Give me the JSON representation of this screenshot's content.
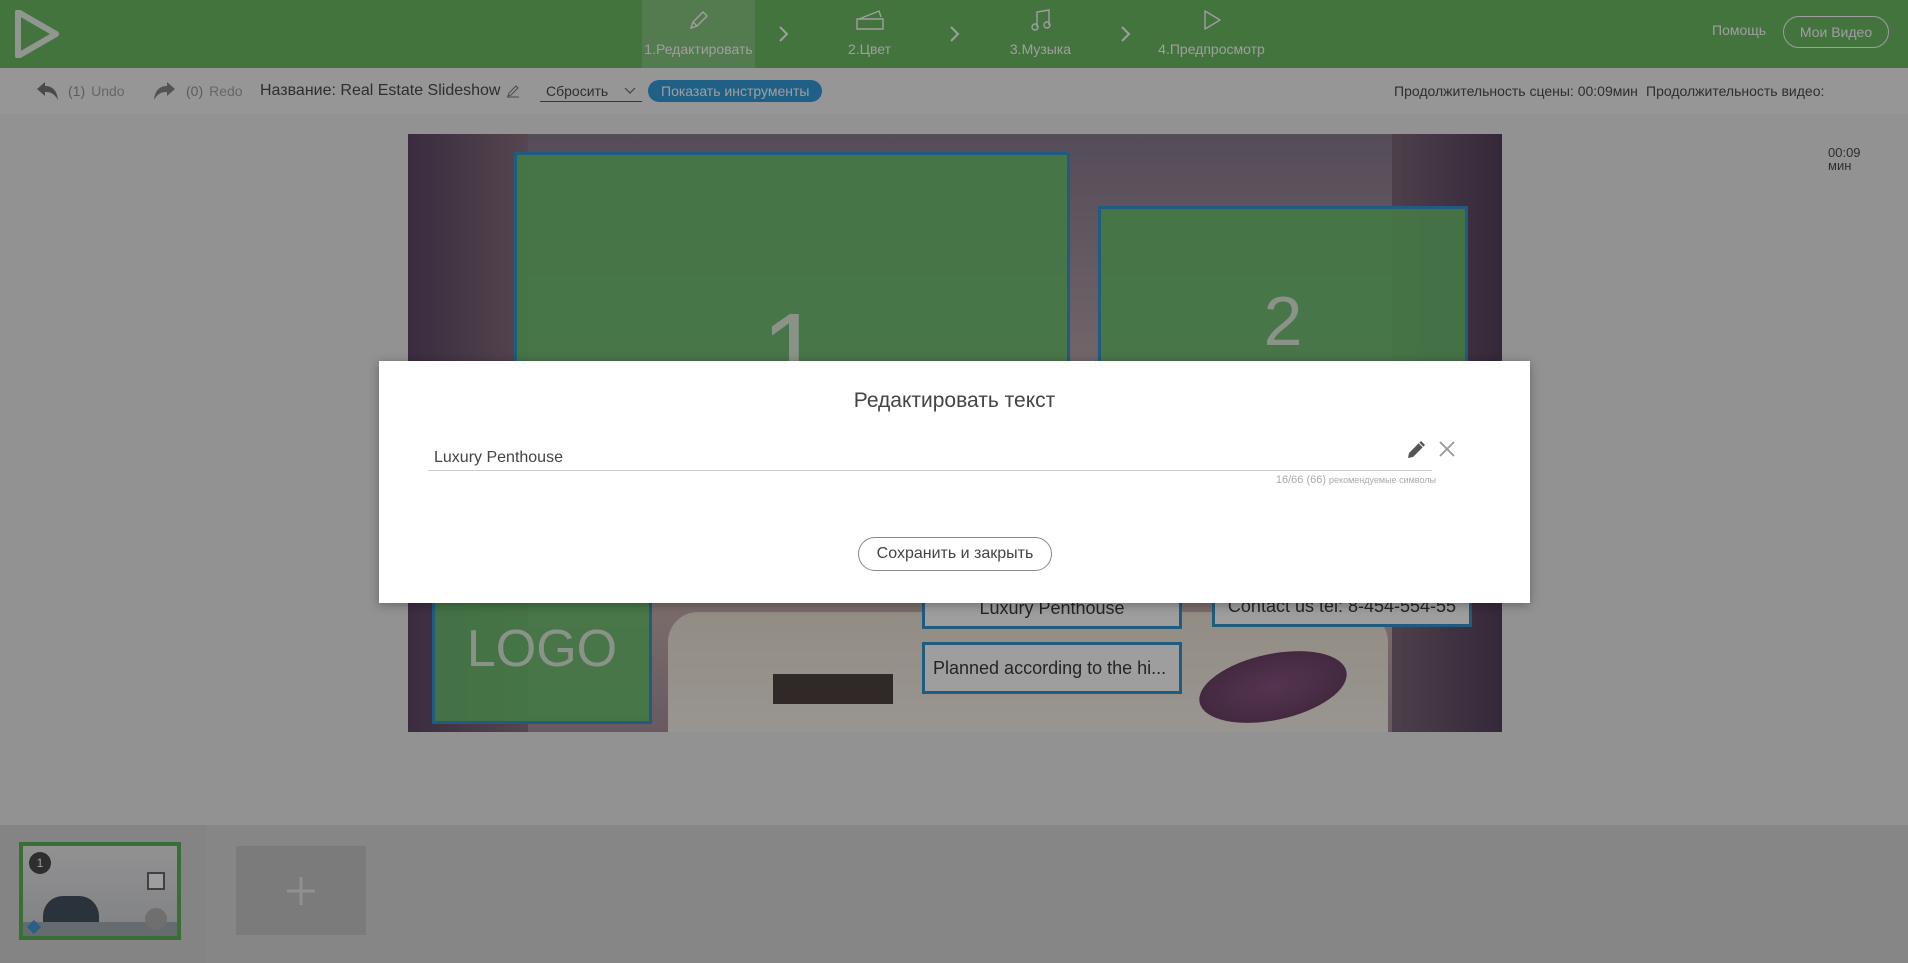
{
  "header": {
    "logo_icon": "play-triangle-logo",
    "steps": [
      {
        "label": "1.Редактировать",
        "icon": "pencil-icon",
        "active": true
      },
      {
        "label": "2.Цвет",
        "icon": "palette-icon",
        "active": false
      },
      {
        "label": "3.Музыка",
        "icon": "music-note-icon",
        "active": false
      },
      {
        "label": "4.Предпросмотр",
        "icon": "play-icon",
        "active": false
      }
    ],
    "help_label": "Помощь",
    "my_videos_label": "Мои Видео"
  },
  "toolbar": {
    "undo_count": "(1)",
    "undo_label": "Undo",
    "redo_count": "(0)",
    "redo_label": "Redo",
    "title_label": "Название: Real Estate Slideshow",
    "reset_label": "Сбросить",
    "tools_label": "Показать инструменты",
    "scene_duration": "Продолжительность сцены: 00:09мин",
    "video_duration_label": "Продолжительность видео:",
    "video_duration_time": "00:09",
    "video_duration_unit": "мин"
  },
  "stage": {
    "placeholder_1": "1",
    "placeholder_2": "2",
    "logo": "LOGO",
    "title_text": "Luxury Penthouse",
    "contact_text": "Contact us tel: 8-454-554-55",
    "desc_text": "Planned according to the hi..."
  },
  "modal": {
    "title": "Редактировать текст",
    "input_value": "Luxury Penthouse",
    "char_count": "16/66 (66)",
    "char_hint": "рекомендуемые символы",
    "save_label": "Сохранить и закрыть"
  },
  "bottom": {
    "slide_number": "1",
    "add_label": "+"
  },
  "colors": {
    "header_green": "#59b351",
    "accent_blue": "#1a8fd6",
    "placeholder_green": "#5cba5f",
    "frame_blue": "#1b86c9"
  }
}
